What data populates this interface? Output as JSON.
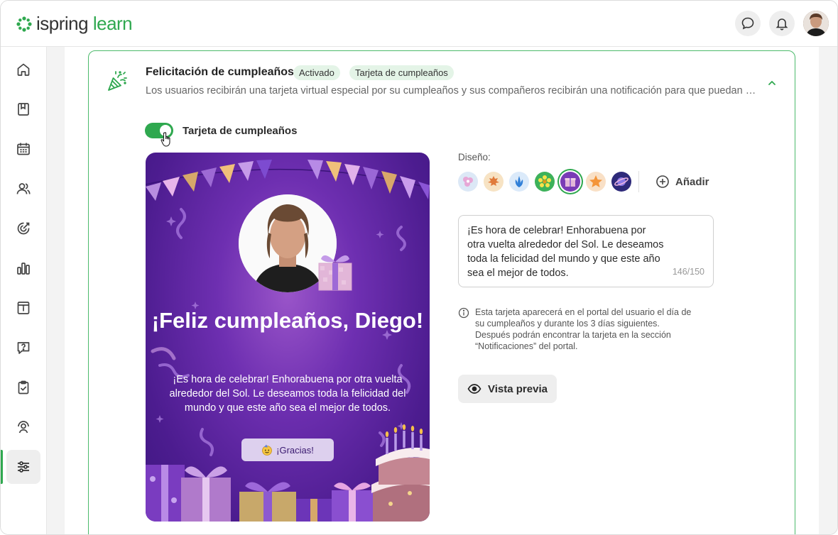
{
  "header": {
    "logo_word1": "ispring",
    "logo_word2": "learn",
    "chat_icon": "chat-bubble-icon",
    "bell_icon": "bell-icon"
  },
  "sidebar": {
    "items": [
      {
        "name": "home",
        "icon": "home-icon"
      },
      {
        "name": "library",
        "icon": "book-icon"
      },
      {
        "name": "calendar",
        "icon": "calendar-icon"
      },
      {
        "name": "users",
        "icon": "users-icon"
      },
      {
        "name": "goals",
        "icon": "target-icon"
      },
      {
        "name": "reports",
        "icon": "bar-chart-icon"
      },
      {
        "name": "news",
        "icon": "news-icon"
      },
      {
        "name": "questions",
        "icon": "question-icon"
      },
      {
        "name": "tasks",
        "icon": "clipboard-icon"
      },
      {
        "name": "support",
        "icon": "support-icon"
      },
      {
        "name": "settings",
        "icon": "sliders-icon",
        "active": true
      }
    ]
  },
  "section": {
    "title": "Felicitación de cumpleaños",
    "badge_status": "Activado",
    "badge_type": "Tarjeta de cumpleaños",
    "description": "Los usuarios recibirán una tarjeta virtual especial por su cumpleaños y sus compañeros recibirán una notificación para que puedan felici..."
  },
  "toggle": {
    "label": "Tarjeta de cumpleaños",
    "on": true
  },
  "birthday_card": {
    "title": "¡Feliz cumpleaños, Diego!",
    "message": "¡Es hora de celebrar! Enhorabuena por otra vuelta alrededor del Sol. Le deseamos toda la felicidad del mundo y que este año sea el mejor de todos.",
    "button_label": "¡Gracias!"
  },
  "design": {
    "label": "Diseño:",
    "add_label": "Añadir",
    "selected_index": 4,
    "swatches": [
      {
        "name": "flowers",
        "color": "#f2c9e0"
      },
      {
        "name": "leaves",
        "color": "#f6d7a8"
      },
      {
        "name": "blue-leaf",
        "color": "#cfe4f7"
      },
      {
        "name": "daisy",
        "color": "#2fa84f"
      },
      {
        "name": "gift",
        "color": "#7a3bb6"
      },
      {
        "name": "starfish",
        "color": "#f7d2a8"
      },
      {
        "name": "planet",
        "color": "#2e2a7a"
      }
    ]
  },
  "message_field": {
    "value": "¡Es hora de celebrar! Enhorabuena por otra vuelta alrededor del Sol. Le deseamos toda la felicidad del mundo y que este año sea el mejor de todos.",
    "counter": "146/150"
  },
  "info": {
    "text": "Esta tarjeta aparecerá en el portal del usuario el día de su cumpleaños y durante los 3 días siguientes. Después podrán encontrar la tarjeta en la sección “Notificaciones” del portal."
  },
  "preview": {
    "label": "Vista previa"
  },
  "colors": {
    "accent": "#2fa84f",
    "badge_bg": "#e4f4e7",
    "card_purple": "#5a22a0"
  }
}
